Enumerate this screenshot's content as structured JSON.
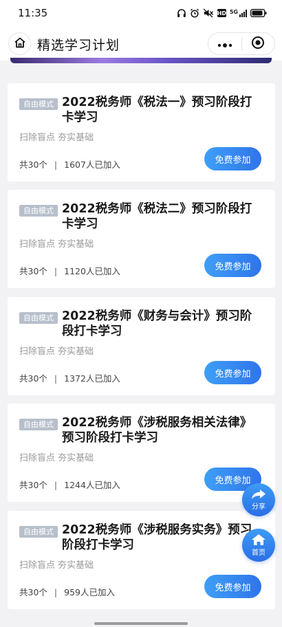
{
  "status_bar": {
    "time": "11:35",
    "icons": [
      "headphones-icon",
      "alarm-icon",
      "mute-icon",
      "hd-icon",
      "signal-5g-icon",
      "battery-icon"
    ],
    "hd_label": "HD",
    "network_label": "5G"
  },
  "nav": {
    "title": "精选学习计划",
    "home_icon": "home-icon",
    "more_icon": "more-dots-icon",
    "close_icon": "target-close-icon"
  },
  "cards": [
    {
      "badge": "自由模式",
      "title": "2022税务师《税法一》预习阶段打卡学习",
      "subtitle": "扫除盲点 夯实基础",
      "count": "共30个",
      "separator": "|",
      "joined": "1607人已加入",
      "button": "免费参加"
    },
    {
      "badge": "自由模式",
      "title": "2022税务师《税法二》预习阶段打卡学习",
      "subtitle": "扫除盲点 夯实基础",
      "count": "共30个",
      "separator": "|",
      "joined": "1120人已加入",
      "button": "免费参加"
    },
    {
      "badge": "自由模式",
      "title": "2022税务师《财务与会计》预习阶段打卡学习",
      "subtitle": "扫除盲点 夯实基础",
      "count": "共30个",
      "separator": "|",
      "joined": "1372人已加入",
      "button": "免费参加"
    },
    {
      "badge": "自由模式",
      "title": "2022税务师《涉税服务相关法律》预习阶段打卡学习",
      "subtitle": "扫除盲点 夯实基础",
      "count": "共30个",
      "separator": "|",
      "joined": "1244人已加入",
      "button": "免费参加"
    },
    {
      "badge": "自由模式",
      "title": "2022税务师《涉税服务实务》预习阶段打卡学习",
      "subtitle": "扫除盲点 夯实基础",
      "count": "共30个",
      "separator": "|",
      "joined": "959人已加入",
      "button": "免费参加"
    }
  ],
  "fabs": {
    "share_label": "分享",
    "share_icon": "share-arrow-icon",
    "home_label": "首页",
    "home_icon": "house-icon"
  },
  "colors": {
    "accent": "#2f74ea",
    "badge": "#b7bfcb",
    "background": "#f2f2f4"
  }
}
